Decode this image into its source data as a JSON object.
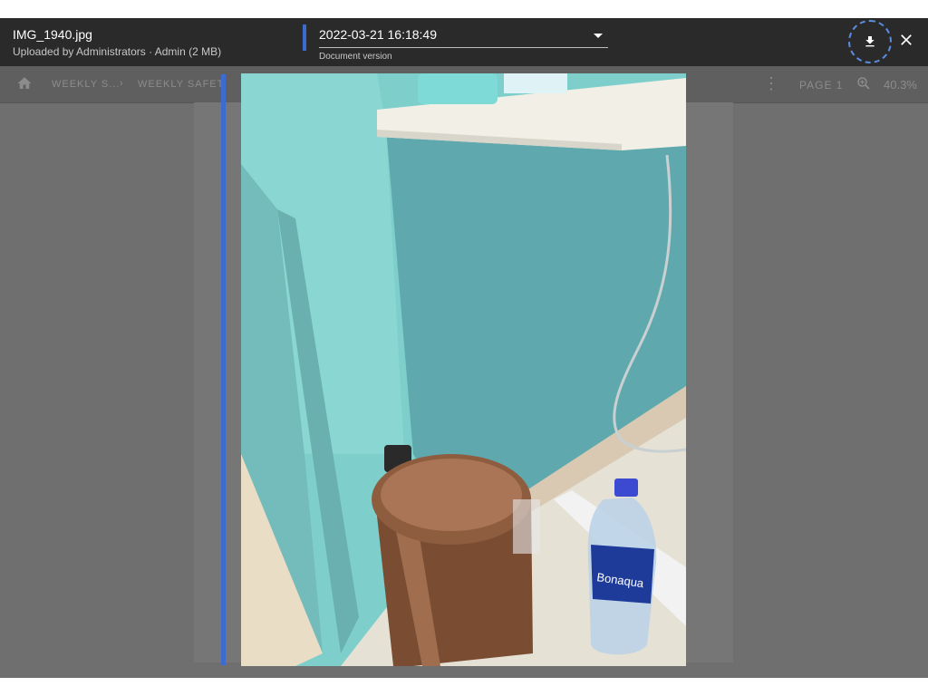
{
  "viewer": {
    "file_name": "IMG_1940.jpg",
    "meta": "Uploaded by Administrators · Admin (2 MB)",
    "version_value": "2022-03-21 16:18:49",
    "version_label": "Document version",
    "download_icon": "download-icon",
    "close_icon": "close-icon"
  },
  "toolbar": {
    "home_icon": "home-icon",
    "breadcrumb": [
      "WEEKLY S...",
      "WEEKLY SAFETY I"
    ],
    "separator": "›",
    "more_icon": "more-vert-icon",
    "page_label": "PAGE 1",
    "zoom_icon": "zoom-icon",
    "zoom": "40.3%"
  },
  "colors": {
    "header_bg": "#2a2a2a",
    "accent": "#3d6cd1",
    "backdrop": "#6f6f6f"
  }
}
